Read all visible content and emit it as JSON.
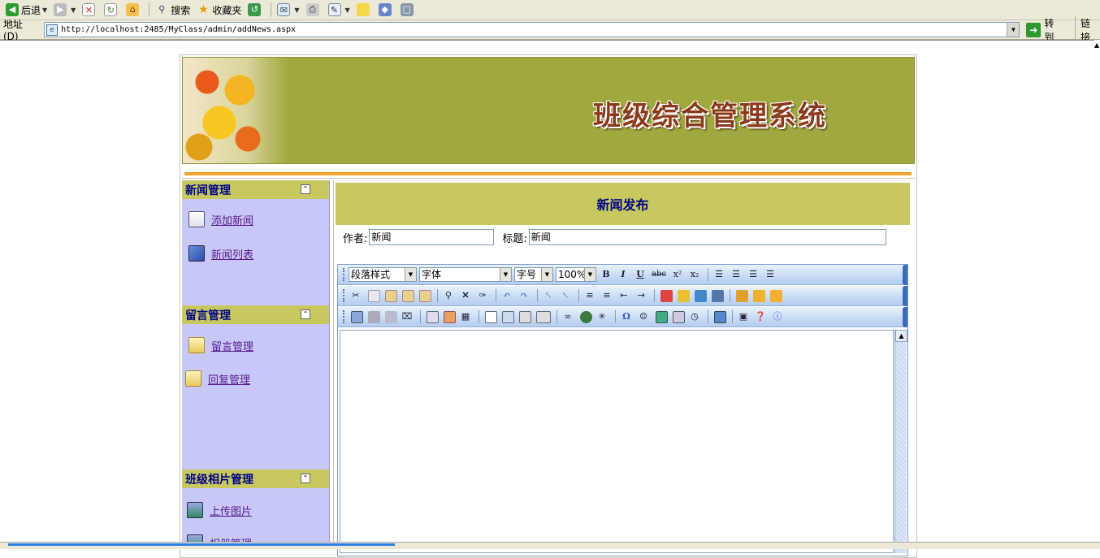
{
  "browser": {
    "toolbar": {
      "back": "后退",
      "search": "搜索",
      "favorites": "收藏夹"
    },
    "address": {
      "label": "地址 (D)",
      "url": "http://localhost:2485/MyClass/admin/addNews.aspx",
      "go": "转到",
      "links": "链接"
    }
  },
  "header": {
    "title": "班级综合管理系统"
  },
  "sidebar": {
    "sections": [
      {
        "title": "新闻管理",
        "items": [
          "添加新闻",
          "新闻列表"
        ]
      },
      {
        "title": "留言管理",
        "items": [
          "留言管理",
          "回复管理"
        ]
      },
      {
        "title": "班级相片管理",
        "items": [
          "上传图片",
          "相册管理"
        ]
      }
    ]
  },
  "main": {
    "heading": "新闻发布",
    "author_label": "作者:",
    "author_value": "新闻",
    "title_label": "标题:",
    "title_value": "新闻"
  },
  "editor": {
    "paragraph_style": "段落样式",
    "font": "字体",
    "size": "字号",
    "zoom": "100%",
    "bold": "B",
    "italic": "I",
    "underline": "U",
    "strike": "abc",
    "superscript": "x²",
    "subscript": "x₂",
    "special_char": "Ω"
  },
  "colors": {
    "banner": "#a0a840",
    "section_header": "#c8c860",
    "sidebar_bg": "#c8c8f8",
    "heading_text": "#00008b",
    "accent_bar": "#f0a830",
    "toolbar_blue": "#c9dcf6"
  }
}
